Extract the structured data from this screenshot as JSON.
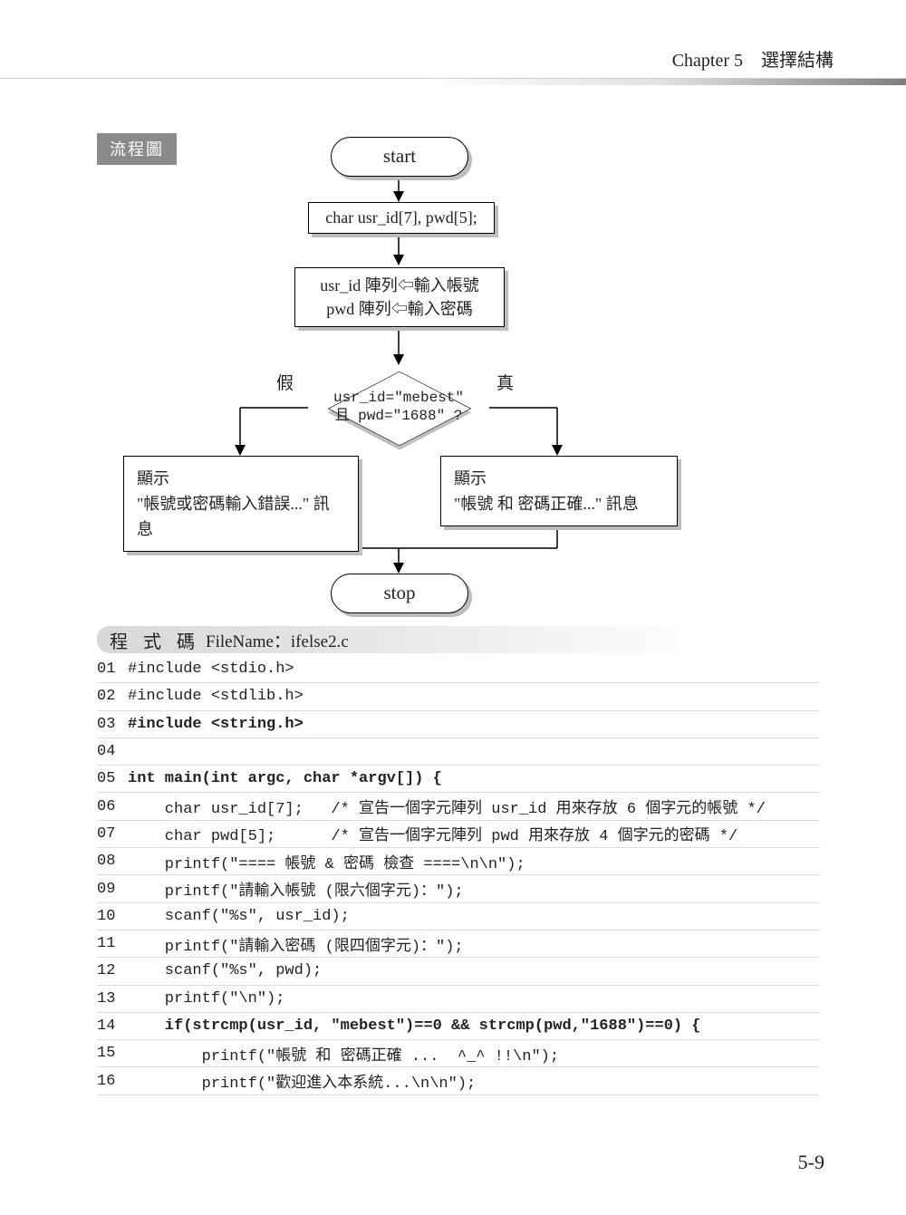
{
  "header": {
    "chapter": "Chapter 5",
    "title": "選擇結構"
  },
  "tags": {
    "flowchart": "流程圖",
    "code": "程 式 碼",
    "filename_label": "FileName：ifelse2.c"
  },
  "flow": {
    "start": "start",
    "decl": "char usr_id[7], pwd[5];",
    "input_l1": "usr_id 陣列⇦輸入帳號",
    "input_l2": "pwd 陣列⇦輸入密碼",
    "cond_l1": "usr_id=\"mebest\"",
    "cond_l2": "且 pwd=\"1688\" ?",
    "false_lbl": "假",
    "true_lbl": "真",
    "false_box_l1": "顯示",
    "false_box_l2": "\"帳號或密碼輸入錯誤...\" 訊息",
    "true_box_l1": "顯示",
    "true_box_l2": "\"帳號 和 密碼正確...\" 訊息",
    "stop": "stop"
  },
  "code": [
    {
      "n": "01",
      "t": "#include <stdio.h>",
      "b": false
    },
    {
      "n": "02",
      "t": "#include <stdlib.h>",
      "b": false
    },
    {
      "n": "03",
      "t": "#include <string.h>",
      "b": true
    },
    {
      "n": "04",
      "t": "",
      "b": false
    },
    {
      "n": "05",
      "t": "int main(int argc, char *argv[]) {",
      "b": true
    },
    {
      "n": "06",
      "t": "    char usr_id[7];   /* 宣告一個字元陣列 usr_id 用來存放 6 個字元的帳號 */",
      "b": false
    },
    {
      "n": "07",
      "t": "    char pwd[5];      /* 宣告一個字元陣列 pwd 用來存放 4 個字元的密碼 */",
      "b": false
    },
    {
      "n": "08",
      "t": "    printf(\"==== 帳號 & 密碼 檢查 ====\\n\\n\");",
      "b": false
    },
    {
      "n": "09",
      "t": "    printf(\"請輸入帳號 (限六個字元)：\");",
      "b": false
    },
    {
      "n": "10",
      "t": "    scanf(\"%s\", usr_id);",
      "b": false
    },
    {
      "n": "11",
      "t": "    printf(\"請輸入密碼 (限四個字元)：\");",
      "b": false
    },
    {
      "n": "12",
      "t": "    scanf(\"%s\", pwd);",
      "b": false
    },
    {
      "n": "13",
      "t": "    printf(\"\\n\");",
      "b": false
    },
    {
      "n": "14",
      "t": "    if(strcmp(usr_id, \"mebest\")==0 && strcmp(pwd,\"1688\")==0) {",
      "b": true
    },
    {
      "n": "15",
      "t": "        printf(\"帳號 和 密碼正確 ...  ^_^ !!\\n\");",
      "b": false
    },
    {
      "n": "16",
      "t": "        printf(\"歡迎進入本系統...\\n\\n\");",
      "b": false
    }
  ],
  "pagenum": "5-9"
}
